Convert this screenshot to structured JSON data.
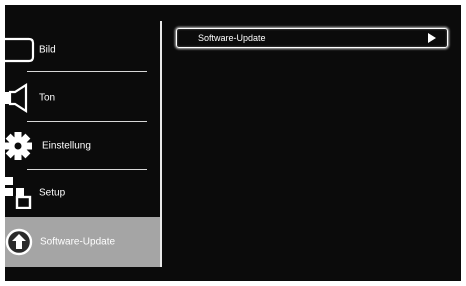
{
  "menu": {
    "items": [
      {
        "label": "Bild",
        "icon": "picture-icon"
      },
      {
        "label": "Ton",
        "icon": "speaker-icon"
      },
      {
        "label": "Einstellung",
        "icon": "gear-icon"
      },
      {
        "label": "Setup",
        "icon": "setup-icon"
      },
      {
        "label": "Software-Update",
        "icon": "update-arrow-icon",
        "selected": true
      }
    ]
  },
  "submenu": {
    "items": [
      {
        "label": "Software-Update",
        "icon": "play-arrow-icon",
        "highlighted": true
      }
    ]
  },
  "colors": {
    "background": "#0b0b0b",
    "selected_item": "#a5a5a5",
    "text": "#ffffff",
    "separator": "#d8d8d8"
  }
}
